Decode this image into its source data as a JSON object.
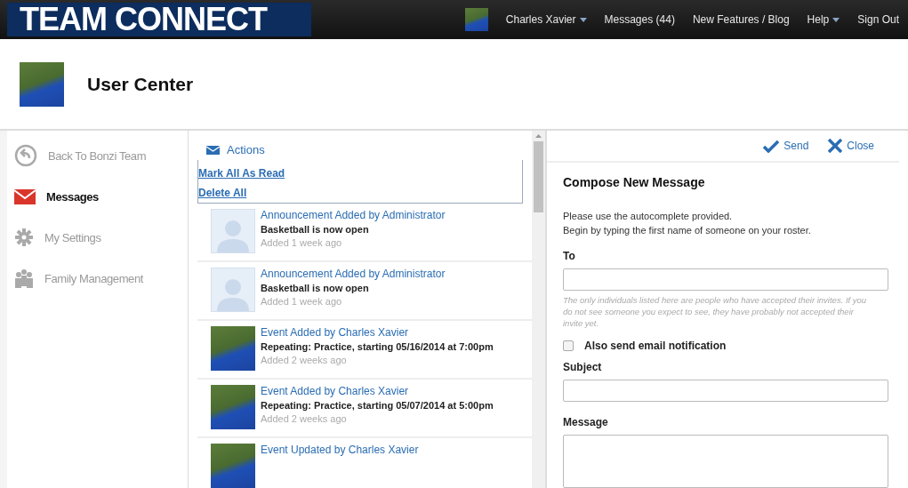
{
  "topbar": {
    "logo": "TEAM CONNECT",
    "user": "Charles Xavier",
    "links": [
      {
        "kind": "link",
        "label": "Messages (44)"
      },
      {
        "kind": "link",
        "label": "New Features / Blog"
      },
      {
        "kind": "menu",
        "label": "Help"
      },
      {
        "kind": "link",
        "label": "Sign Out"
      }
    ]
  },
  "page_title": "User Center",
  "sidebar": {
    "items": [
      {
        "kind": "back",
        "label": "Back To Bonzi Team",
        "selected": false
      },
      {
        "kind": "mail",
        "label": "Messages",
        "selected": true
      },
      {
        "kind": "gear",
        "label": "My Settings",
        "selected": false
      },
      {
        "kind": "family",
        "label": "Family Management",
        "selected": false
      }
    ]
  },
  "actions": {
    "title": "Actions",
    "items": [
      "Mark All As Read",
      "Delete All"
    ]
  },
  "messages": [
    {
      "kind": "placeholder",
      "title": "Announcement Added by Administrator",
      "body": "Basketball is now open",
      "time": "Added 1 week ago"
    },
    {
      "kind": "placeholder",
      "title": "Announcement Added by Administrator",
      "body": "Basketball is now open",
      "time": "Added 1 week ago"
    },
    {
      "kind": "photo",
      "title": "Event Added by Charles Xavier",
      "body": "Repeating: Practice, starting 05/16/2014 at 7:00pm",
      "time": "Added 2 weeks ago"
    },
    {
      "kind": "photo",
      "title": "Event Added by Charles Xavier",
      "body": "Repeating: Practice, starting 05/07/2014 at 5:00pm",
      "time": "Added 2 weeks ago"
    },
    {
      "kind": "photo",
      "title": "Event Updated by Charles Xavier"
    }
  ],
  "compose": {
    "send": "Send",
    "close": "Close",
    "title": "Compose New Message",
    "intro": [
      "Please use the autocomplete provided.",
      "Begin by typing the first name of someone on your roster."
    ],
    "to_label": "To",
    "to_hint": "The only individuals listed here are people who have accepted their invites. If you do not see someone you expect to see, they have probably not accepted their invite yet.",
    "email_notification": {
      "label": "Also send email notification",
      "checked": false
    },
    "subject_label": "Subject",
    "message_label": "Message"
  }
}
